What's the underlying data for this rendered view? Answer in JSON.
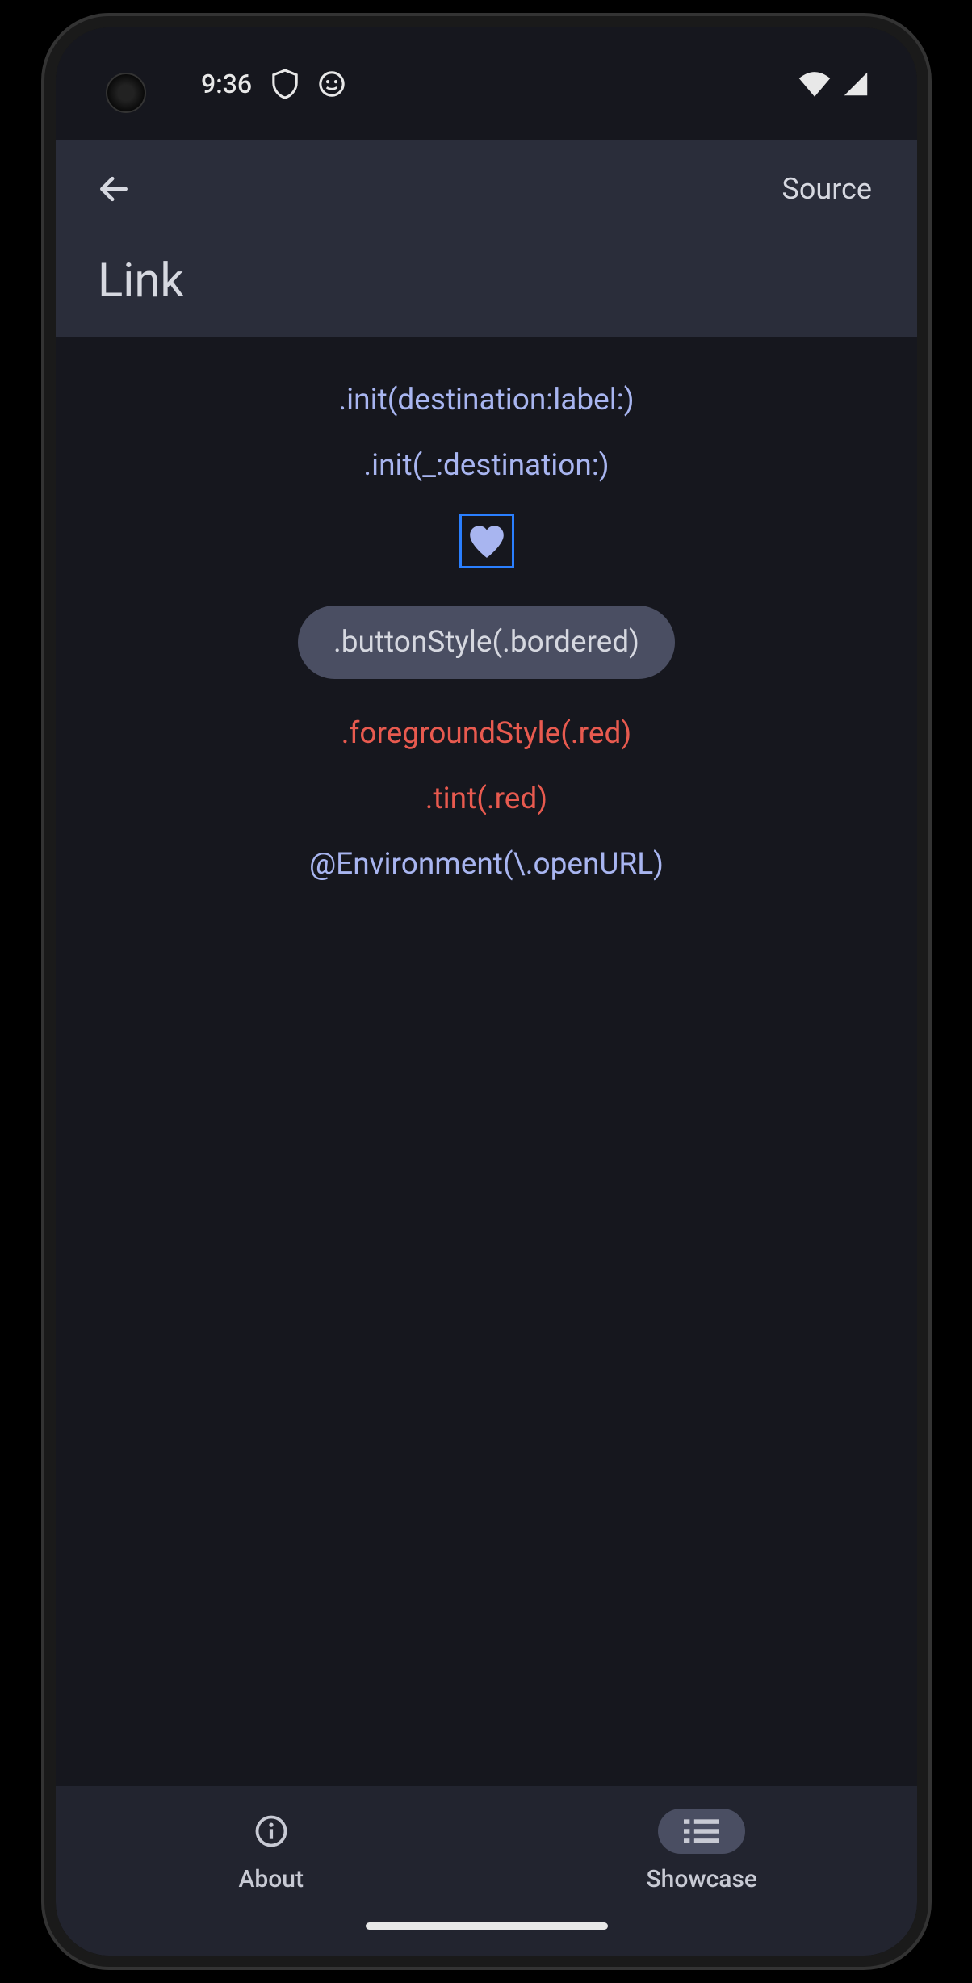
{
  "statusbar": {
    "time": "9:36"
  },
  "header": {
    "source_label": "Source",
    "title": "Link"
  },
  "links": {
    "init_destination_label": ".init(destination:label:)",
    "init_underscore_destination": ".init(_:destination:)",
    "button_style_bordered": ".buttonStyle(.bordered)",
    "foreground_style_red": ".foregroundStyle(.red)",
    "tint_red": ".tint(.red)",
    "environment_openurl": "@Environment(\\.openURL)"
  },
  "bottomnav": {
    "about_label": "About",
    "showcase_label": "Showcase"
  }
}
